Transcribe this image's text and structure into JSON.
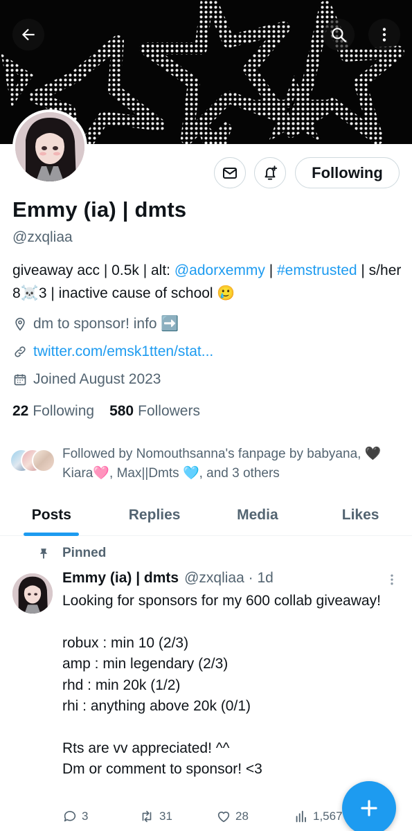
{
  "profile": {
    "display_name": "Emmy (ia) | dmts",
    "handle": "@zxqliaa",
    "bio": {
      "part1": "giveaway acc | 0.5k | alt: ",
      "alt_mention": "@adorxemmy",
      "sep": " | ",
      "hashtag": "#emstrusted",
      "part2": " | s/her 8☠️3 | inactive cause of school 🥲"
    },
    "location": "dm to sponsor! info ➡️",
    "website": "twitter.com/emsk1tten/stat...",
    "joined": "Joined August 2023",
    "following_count": "22",
    "following_label": "Following",
    "followers_count": "580",
    "followers_label": "Followers",
    "followed_by": "Followed by Nomouthsanna's fanpage by babyana, 🖤Kiara🩷, Max||Dmts 🩵, and 3 others"
  },
  "header": {
    "back_icon": "arrow-left-icon",
    "search_icon": "search-icon",
    "more_icon": "more-vertical-icon"
  },
  "buttons": {
    "message_icon": "envelope-icon",
    "notify_icon": "bell-plus-icon",
    "follow_label": "Following"
  },
  "tabs": [
    {
      "label": "Posts",
      "active": true
    },
    {
      "label": "Replies",
      "active": false
    },
    {
      "label": "Media",
      "active": false
    },
    {
      "label": "Likes",
      "active": false
    }
  ],
  "pinned_post": {
    "pinned_label": "Pinned",
    "author_name": "Emmy (ia) | dmts",
    "author_handle": "@zxqliaa · 1d",
    "text": "Looking for sponsors for my 600 collab giveaway!\n\nrobux : min 10 (2/3)\namp : min legendary (2/3)\nrhd : min 20k (1/2)\nrhi : anything above 20k (0/1)\n\nRts are vv appreciated! ^^\nDm or comment to sponsor! <3",
    "replies": "3",
    "reposts": "31",
    "likes": "28",
    "views": "1,567"
  },
  "colors": {
    "accent": "#1d9bf0",
    "text": "#0f1419",
    "secondary": "#536471"
  }
}
